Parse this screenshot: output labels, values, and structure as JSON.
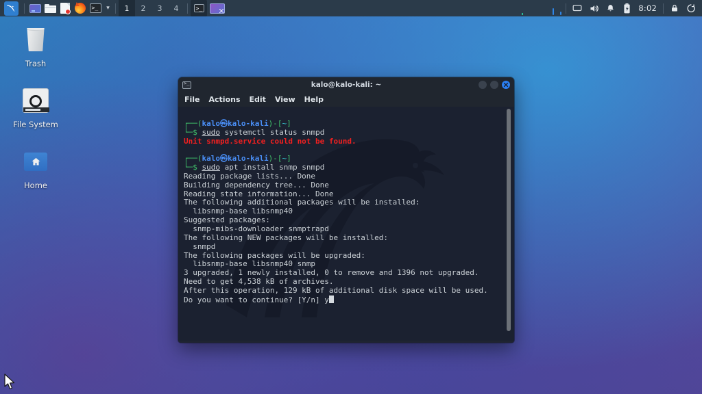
{
  "panel": {
    "menu_button": {
      "name": "Kali Applications Menu",
      "icon": "kali-dragon-icon"
    },
    "launchers": [
      {
        "label": "Terminal Emulator",
        "icon": "display-icon"
      },
      {
        "label": "File Manager",
        "icon": "folder-icon"
      },
      {
        "label": "Text Editor",
        "icon": "document-icon"
      },
      {
        "label": "Firefox ESR",
        "icon": "firefox-icon"
      },
      {
        "label": "Terminal",
        "icon": "terminal-icon"
      },
      {
        "label": "More Applications",
        "icon": "chevron-down-icon"
      }
    ],
    "workspaces": [
      {
        "label": "1",
        "active": true
      },
      {
        "label": "2",
        "active": false
      },
      {
        "label": "3",
        "active": false
      },
      {
        "label": "4",
        "active": false
      }
    ],
    "window_buttons": [
      {
        "label": "kalo@kalo-kali: ~",
        "icon": "terminal-icon"
      },
      {
        "label": "Show Desktop",
        "icon": "desktop-thumbnail-icon"
      }
    ],
    "tray": [
      {
        "name": "display-settings-icon"
      },
      {
        "name": "volume-icon"
      },
      {
        "name": "notification-bell-icon"
      },
      {
        "name": "battery-icon"
      }
    ],
    "clock": "8:02",
    "session": [
      {
        "name": "lock-screen-icon"
      },
      {
        "name": "power-logout-icon"
      }
    ]
  },
  "desktop": {
    "icons": [
      {
        "label": "Trash",
        "icon": "trash-icon"
      },
      {
        "label": "File System",
        "icon": "drive-icon"
      },
      {
        "label": "Home",
        "icon": "home-folder-icon"
      }
    ]
  },
  "terminal": {
    "title": "kalo@kalo-kali: ~",
    "menu": [
      "File",
      "Actions",
      "Edit",
      "View",
      "Help"
    ],
    "window_controls": [
      "minimize",
      "maximize",
      "close"
    ],
    "prompt": {
      "user": "kalo",
      "at": "ⓢ",
      "host": "kalo-kali",
      "cwd": "~",
      "sigil": "$"
    },
    "blocks": [
      {
        "command": "sudo systemctl status snmpd",
        "sudo": "sudo",
        "output": [
          {
            "text": "Unit snmpd.service could not be found.",
            "color": "red"
          }
        ]
      },
      {
        "command": "sudo apt install snmp snmpd",
        "sudo": "sudo",
        "output": [
          {
            "text": "Reading package lists... Done",
            "color": "gray"
          },
          {
            "text": "Building dependency tree... Done",
            "color": "gray"
          },
          {
            "text": "Reading state information... Done",
            "color": "gray"
          },
          {
            "text": "The following additional packages will be installed:",
            "color": "gray"
          },
          {
            "text": "  libsnmp-base libsnmp40",
            "color": "gray"
          },
          {
            "text": "Suggested packages:",
            "color": "gray"
          },
          {
            "text": "  snmp-mibs-downloader snmptrapd",
            "color": "gray"
          },
          {
            "text": "The following NEW packages will be installed:",
            "color": "gray"
          },
          {
            "text": "  snmpd",
            "color": "gray"
          },
          {
            "text": "The following packages will be upgraded:",
            "color": "gray"
          },
          {
            "text": "  libsnmp-base libsnmp40 snmp",
            "color": "gray"
          },
          {
            "text": "3 upgraded, 1 newly installed, 0 to remove and 1396 not upgraded.",
            "color": "gray"
          },
          {
            "text": "Need to get 4,538 kB of archives.",
            "color": "gray"
          },
          {
            "text": "After this operation, 129 kB of additional disk space will be used.",
            "color": "gray"
          }
        ],
        "confirm_prompt": "Do you want to continue? [Y/n] ",
        "typed_answer": "y"
      }
    ]
  },
  "colors": {
    "panel_bg": "#2b3b4a",
    "terminal_bg": "#1b2130",
    "titlebar_bg": "#20262f",
    "accent_blue": "#2a7ff2",
    "prompt_green": "#41c46c",
    "prompt_blue": "#4a8ff7",
    "prompt_cyan": "#36c9d0",
    "error_red": "#f02020",
    "text_fg": "#d6dbe0"
  }
}
